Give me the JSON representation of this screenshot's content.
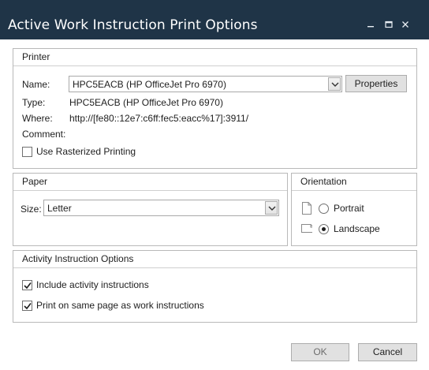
{
  "window": {
    "title": "Active Work Instruction Print Options",
    "minimize_glyph": "—",
    "maximize_glyph": "☐",
    "close_glyph": "✕"
  },
  "printer": {
    "header": "Printer",
    "name_label": "Name:",
    "name_value": "HPC5EACB (HP OfficeJet Pro 6970)",
    "properties_button": "Properties",
    "type_label": "Type:",
    "type_value": "HPC5EACB (HP OfficeJet Pro 6970)",
    "where_label": "Where:",
    "where_value": "http://[fe80::12e7:c6ff:fec5:eacc%17]:3911/",
    "comment_label": "Comment:",
    "comment_value": "",
    "rasterized_label": "Use Rasterized Printing",
    "rasterized_checked": false
  },
  "paper": {
    "header": "Paper",
    "size_label": "Size:",
    "size_value": "Letter"
  },
  "orientation": {
    "header": "Orientation",
    "portrait_label": "Portrait",
    "landscape_label": "Landscape",
    "selected": "Landscape"
  },
  "activity": {
    "header": "Activity Instruction Options",
    "include_label": "Include activity instructions",
    "include_checked": true,
    "same_page_label": "Print on same page as work instructions",
    "same_page_checked": true
  },
  "footer": {
    "ok_label": "OK",
    "cancel_label": "Cancel"
  },
  "colors": {
    "titlebar": "#1f3447",
    "border": "#b9b9b9",
    "button_face": "#e1e1e1"
  }
}
